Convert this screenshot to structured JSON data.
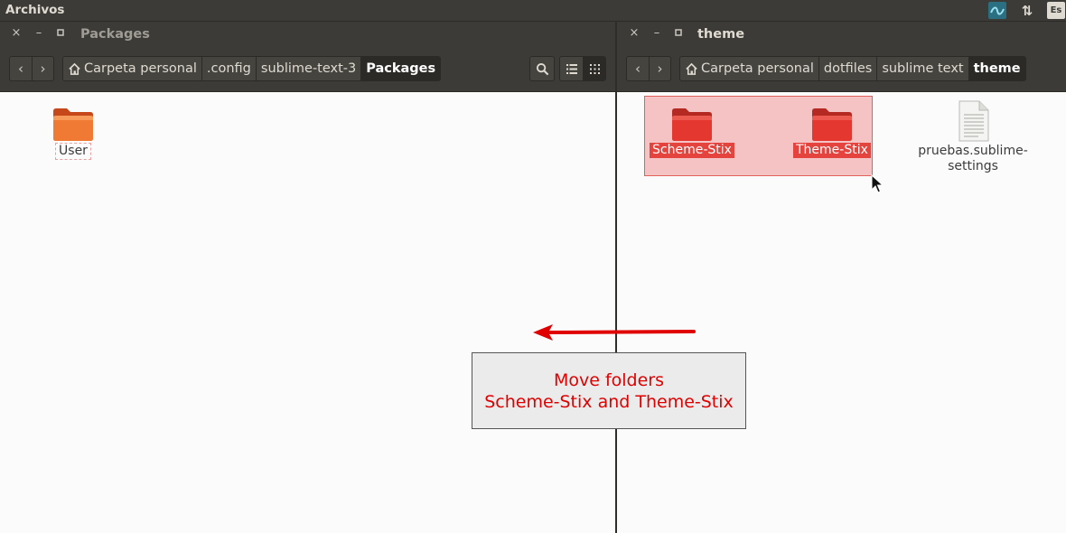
{
  "top_panel": {
    "app_title": "Archivos",
    "network_icon": "network-wave-icon",
    "transfer_icon": "up-down-arrows-icon",
    "language_label": "Es"
  },
  "left_pane": {
    "window_controls": {
      "close": "×",
      "minimize": "–",
      "maximize": "▫"
    },
    "title": "Packages",
    "nav": {
      "back": "back-chevron-icon",
      "forward": "forward-chevron-icon"
    },
    "breadcrumbs": [
      {
        "label": "Carpeta personal",
        "icon": "home-icon"
      },
      {
        "label": ".config"
      },
      {
        "label": "sublime-text-3"
      },
      {
        "label": "Packages",
        "active": true
      }
    ],
    "search_icon": "search-icon",
    "view_modes": [
      "list-view-icon",
      "grid-view-icon"
    ],
    "items": [
      {
        "name": "User",
        "type": "folder",
        "color": "#e8611d"
      }
    ]
  },
  "right_pane": {
    "window_controls": {
      "close": "×",
      "minimize": "–",
      "maximize": "▫"
    },
    "title": "theme",
    "nav": {
      "back": "back-chevron-icon",
      "forward": "forward-chevron-icon"
    },
    "breadcrumbs": [
      {
        "label": "Carpeta personal",
        "icon": "home-icon"
      },
      {
        "label": "dotfiles"
      },
      {
        "label": "sublime text"
      },
      {
        "label": "theme",
        "active": true
      }
    ],
    "items": [
      {
        "name": "Scheme-Stix",
        "type": "folder",
        "selected": true,
        "color": "#e5433e"
      },
      {
        "name": "Theme-Stix",
        "type": "folder",
        "selected": true,
        "color": "#e5433e"
      },
      {
        "name_line1": "pruebas.sublime-",
        "name_line2": "settings",
        "type": "file"
      }
    ]
  },
  "annotation": {
    "line1": "Move folders",
    "line2": "Scheme-Stix and Theme-Stix",
    "color": "#e00000"
  }
}
